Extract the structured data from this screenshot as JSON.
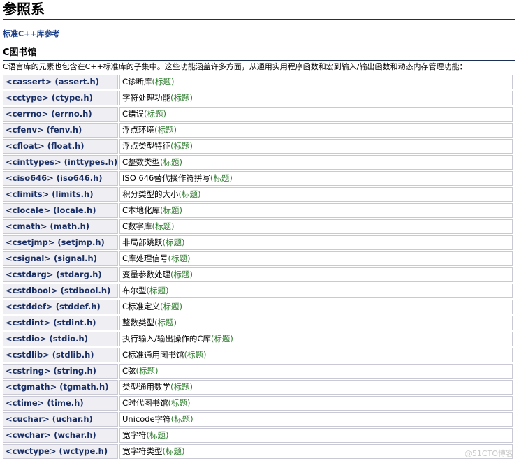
{
  "page": {
    "title": "参照系",
    "breadcrumb": "标准C++库参考",
    "section_title": "C图书馆",
    "description": "C语言库的元素也包含在C++标准库的子集中。这些功能涵盖许多方面，从通用实用程序函数和宏到输入/输出函数和动态内存管理功能："
  },
  "tag_label": "(标题)",
  "headers": [
    {
      "name": "<cassert> (assert.h)",
      "desc": "C诊断库"
    },
    {
      "name": "<cctype> (ctype.h)",
      "desc": "字符处理功能"
    },
    {
      "name": "<cerrno> (errno.h)",
      "desc": "C错误"
    },
    {
      "name": "<cfenv> (fenv.h)",
      "desc": "浮点环境"
    },
    {
      "name": "<cfloat> (float.h)",
      "desc": "浮点类型特征"
    },
    {
      "name": "<cinttypes> (inttypes.h)",
      "desc": "C整数类型"
    },
    {
      "name": "<ciso646> (iso646.h)",
      "desc": "ISO 646替代操作符拼写"
    },
    {
      "name": "<climits> (limits.h)",
      "desc": "积分类型的大小"
    },
    {
      "name": "<clocale> (locale.h)",
      "desc": "C本地化库"
    },
    {
      "name": "<cmath> (math.h)",
      "desc": "C数字库"
    },
    {
      "name": "<csetjmp> (setjmp.h)",
      "desc": "非局部跳跃"
    },
    {
      "name": "<csignal> (signal.h)",
      "desc": "C库处理信号"
    },
    {
      "name": "<cstdarg> (stdarg.h)",
      "desc": "变量参数处理"
    },
    {
      "name": "<cstdbool> (stdbool.h)",
      "desc": "布尔型"
    },
    {
      "name": "<cstddef> (stddef.h)",
      "desc": "C标准定义"
    },
    {
      "name": "<cstdint> (stdint.h)",
      "desc": "整数类型"
    },
    {
      "name": "<cstdio> (stdio.h)",
      "desc": "执行输入/输出操作的C库"
    },
    {
      "name": "<cstdlib> (stdlib.h)",
      "desc": "C标准通用图书馆"
    },
    {
      "name": "<cstring> (string.h)",
      "desc": "C弦"
    },
    {
      "name": "<ctgmath> (tgmath.h)",
      "desc": "类型通用数学"
    },
    {
      "name": "<ctime> (time.h)",
      "desc": "C时代图书馆"
    },
    {
      "name": "<cuchar> (uchar.h)",
      "desc": "Unicode字符"
    },
    {
      "name": "<cwchar> (wchar.h)",
      "desc": "宽字符"
    },
    {
      "name": "<cwctype> (wctype.h)",
      "desc": "宽字符类型"
    }
  ],
  "watermark": "@51CTO博客"
}
